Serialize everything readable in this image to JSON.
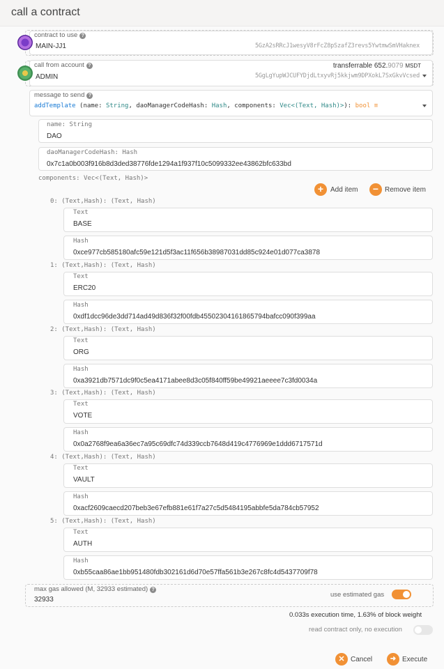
{
  "window": {
    "title": "call a contract"
  },
  "contract": {
    "label": "contract to use",
    "value": "MAIN-JJ1",
    "address": "5GzA2sRRcJ1wesyV8rFcZ8pSzafZ3revs5YwtmwSmVHaknex"
  },
  "account": {
    "label": "call from account",
    "value": "ADMIN",
    "address": "5GgLgYupWJCUFYDjdLtxyvRj5kkjwm9DPXokL7SxGkvVcsed",
    "transferrable_label": "transferrable",
    "balance_int": "652.",
    "balance_dec": "9079",
    "unit": "MSDT"
  },
  "message": {
    "label": "message to send",
    "method": "addTemplate",
    "p1": " (name: ",
    "t1": "String",
    "p2": ", daoManagerCodeHash: ",
    "t2": "Hash",
    "p3": ", components: ",
    "t3": "Vec<(Text, Hash)>",
    "p4": "): ",
    "ret": "bool",
    "db_icon": "database-icon"
  },
  "params": {
    "name_label": "name: String",
    "name_value": "DAO",
    "hash_label": "daoManagerCodeHash: Hash",
    "hash_value": "0x7c1a0b003f916b8d3ded38776fde1294a1f937f10c5099332ee43862bfc633bd",
    "components_label": "components: Vec<(Text, Hash)>",
    "add_item": "Add item",
    "remove_item": "Remove item"
  },
  "components": [
    {
      "label": "0: (Text,Hash): (Text, Hash)",
      "text_label": "Text",
      "text": "BASE",
      "hash_label": "Hash",
      "hash": "0xce977cb585180afc59e121d5f3ac11f656b38987031dd85c924e01d077ca3878"
    },
    {
      "label": "1: (Text,Hash): (Text, Hash)",
      "text_label": "Text",
      "text": "ERC20",
      "hash_label": "Hash",
      "hash": "0xdf1dcc96de3dd714ad49d836f32f00fdb45502304161865794bafcc090f399aa"
    },
    {
      "label": "2: (Text,Hash): (Text, Hash)",
      "text_label": "Text",
      "text": "ORG",
      "hash_label": "Hash",
      "hash": "0xa3921db7571dc9f0c5ea4171abee8d3c05f840ff59be49921aeeee7c3fd0034a"
    },
    {
      "label": "3: (Text,Hash): (Text, Hash)",
      "text_label": "Text",
      "text": "VOTE",
      "hash_label": "Hash",
      "hash": "0x0a2768f9ea6a36ec7a95c69dfc74d339ccb7648d419c4776969e1ddd6717571d"
    },
    {
      "label": "4: (Text,Hash): (Text, Hash)",
      "text_label": "Text",
      "text": "VAULT",
      "hash_label": "Hash",
      "hash": "0xacf2609caecd207beb3e67efb881e61f7a27c5d5484195abbfe5da784cb57952"
    },
    {
      "label": "5: (Text,Hash): (Text, Hash)",
      "text_label": "Text",
      "text": "AUTH",
      "hash_label": "Hash",
      "hash": "0xb55caa86ae1bb951480fdb302161d6d70e57ffa561b3e267c8fc4d5437709f78"
    }
  ],
  "gas": {
    "label": "max gas allowed (M, 32933 estimated)",
    "value": "32933",
    "toggle_label": "use estimated gas",
    "toggle_on": true,
    "exec_info": "0.033s execution time, 1.63% of block weight"
  },
  "readonly": {
    "label": "read contract only, no execution",
    "toggle_on": false
  },
  "actions": {
    "cancel": "Cancel",
    "execute": "Execute"
  },
  "colors": {
    "accent": "#f19135",
    "type": "#2f8987",
    "method": "#1a7bd5"
  }
}
